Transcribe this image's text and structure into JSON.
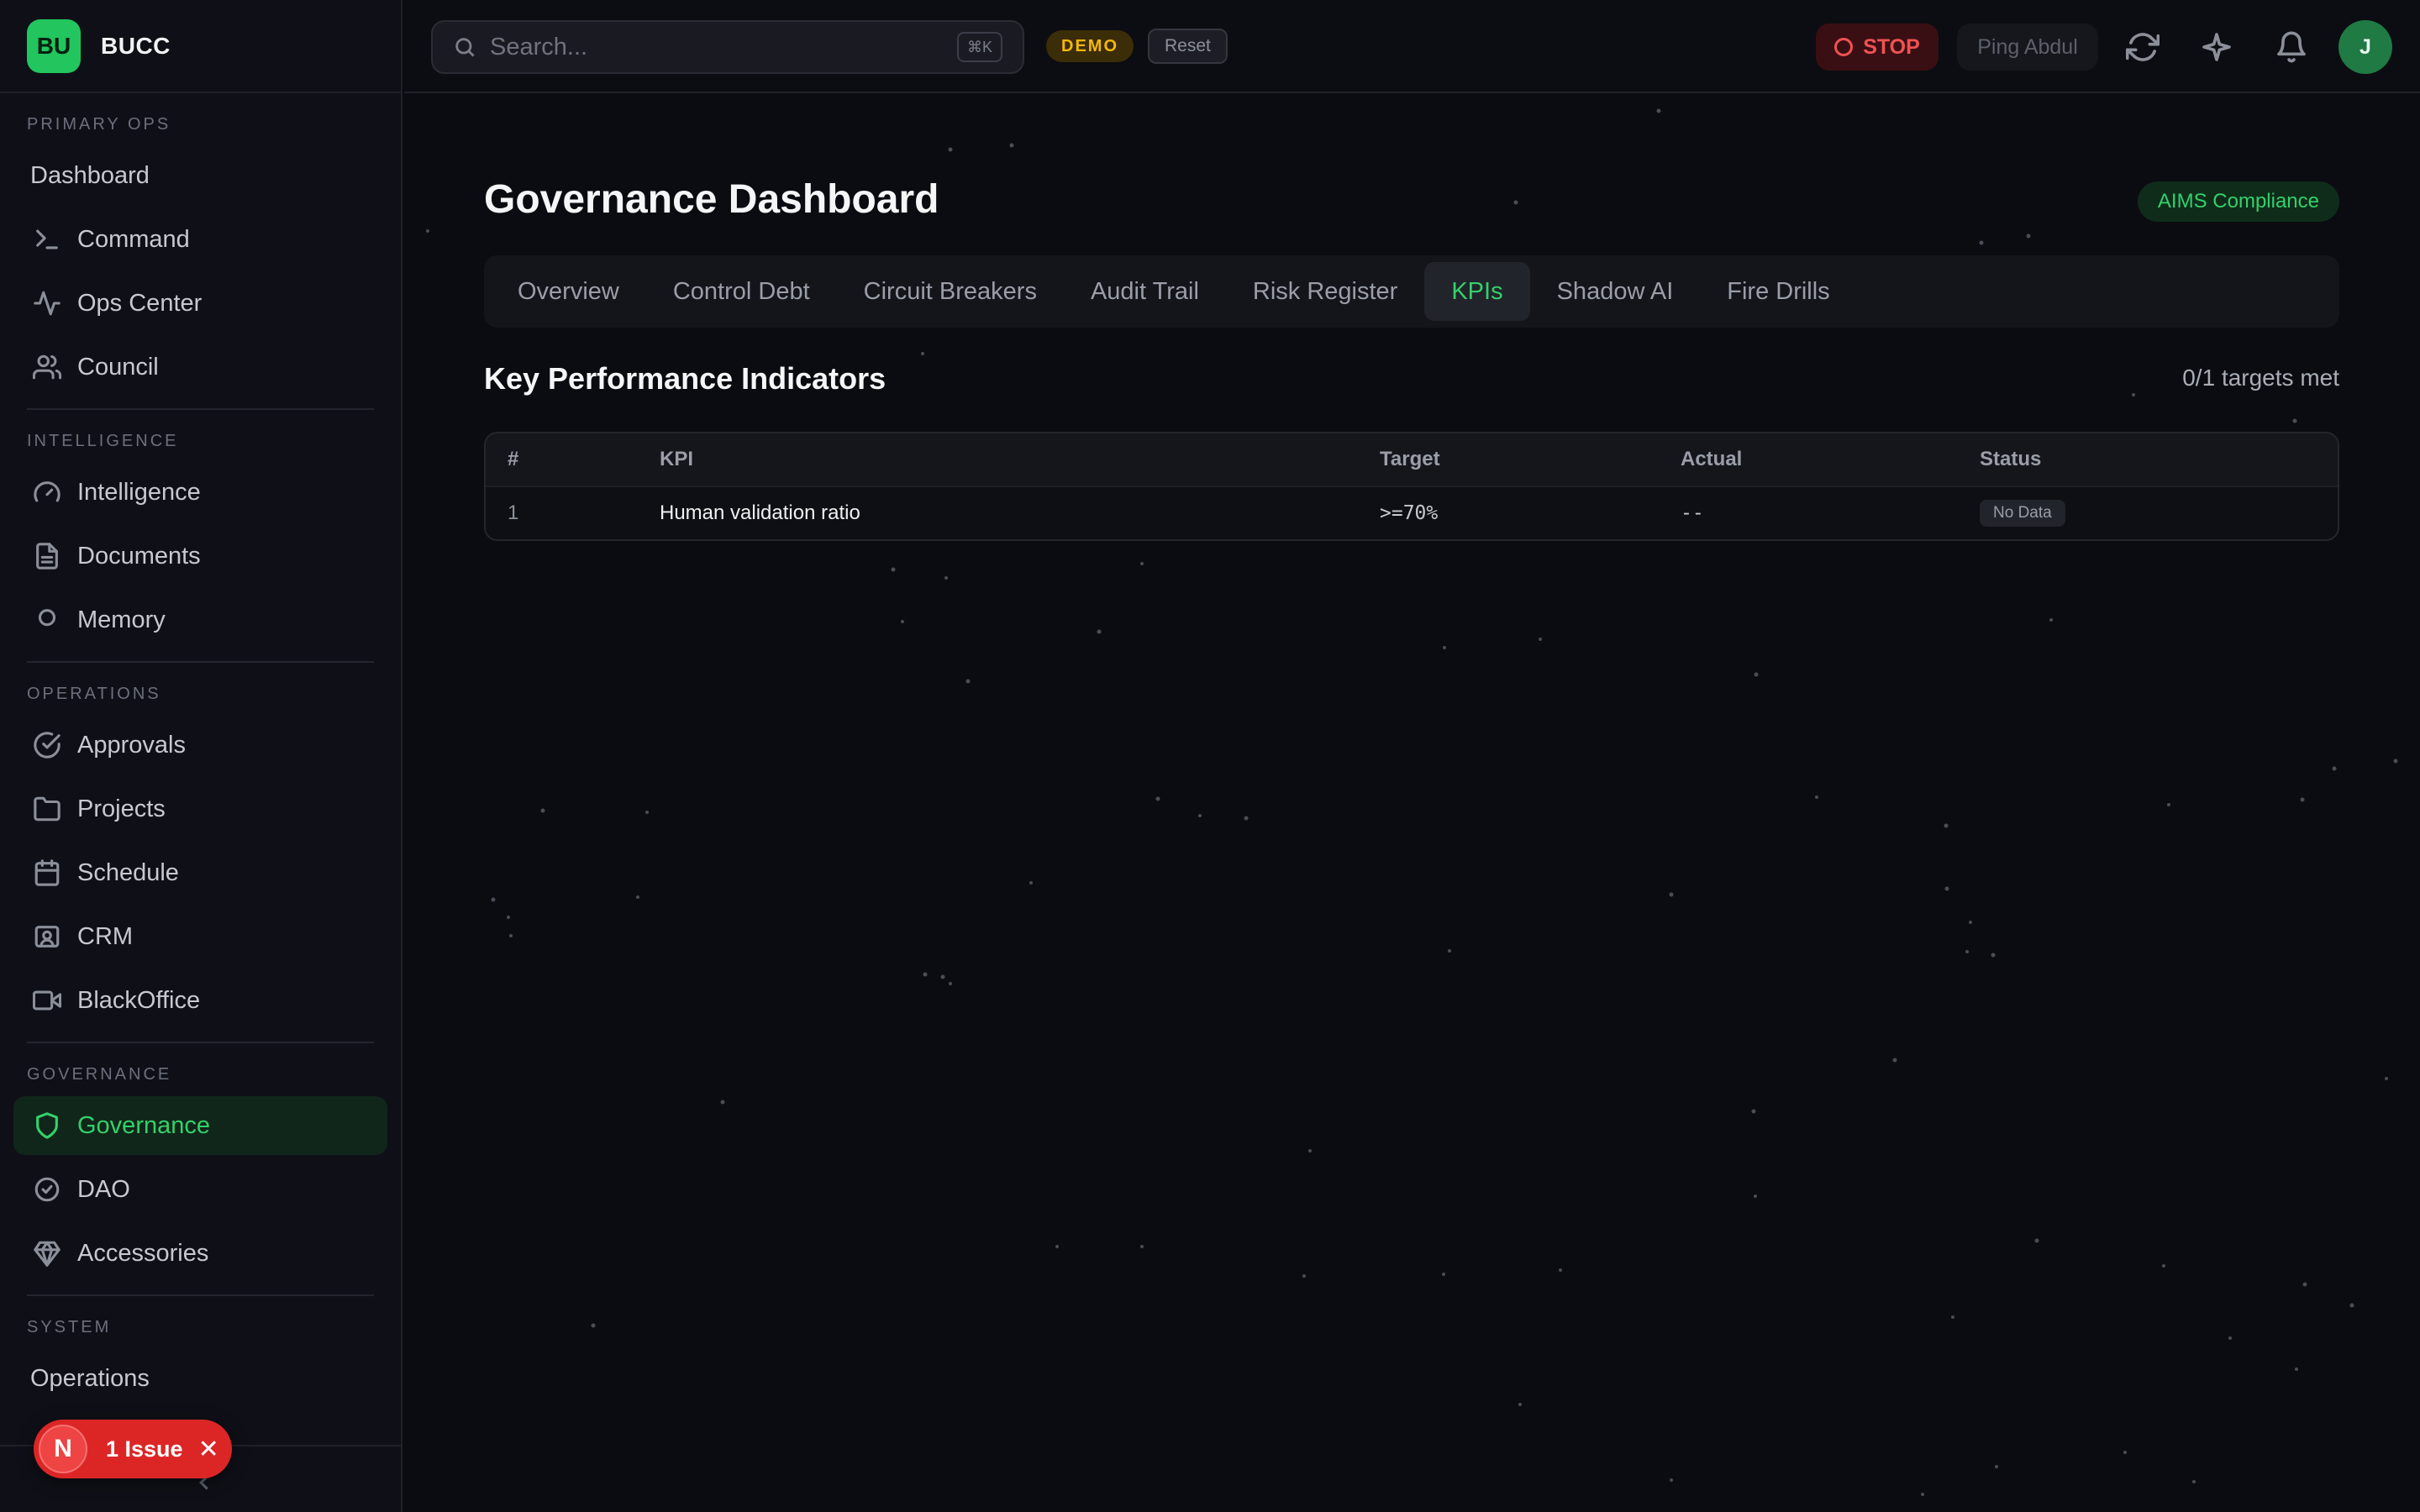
{
  "brand": {
    "logo_text": "BU",
    "name": "BUCC",
    "accent": "#22c55e"
  },
  "sidebar": {
    "sections": [
      {
        "title": "PRIMARY OPS",
        "items": [
          {
            "label": "Dashboard",
            "icon": "none"
          },
          {
            "label": "Command",
            "icon": "terminal-icon"
          },
          {
            "label": "Ops Center",
            "icon": "activity-icon"
          },
          {
            "label": "Council",
            "icon": "users-icon"
          }
        ]
      },
      {
        "title": "INTELLIGENCE",
        "items": [
          {
            "label": "Intelligence",
            "icon": "gauge-icon"
          },
          {
            "label": "Documents",
            "icon": "document-icon"
          },
          {
            "label": "Memory",
            "icon": "circle-icon"
          }
        ]
      },
      {
        "title": "OPERATIONS",
        "items": [
          {
            "label": "Approvals",
            "icon": "check-circle-icon"
          },
          {
            "label": "Projects",
            "icon": "folder-icon"
          },
          {
            "label": "Schedule",
            "icon": "calendar-icon"
          },
          {
            "label": "CRM",
            "icon": "contact-card-icon"
          },
          {
            "label": "BlackOffice",
            "icon": "video-icon"
          }
        ]
      },
      {
        "title": "GOVERNANCE",
        "items": [
          {
            "label": "Governance",
            "icon": "shield-icon",
            "active": true
          },
          {
            "label": "DAO",
            "icon": "badge-check-icon"
          },
          {
            "label": "Accessories",
            "icon": "gem-icon"
          }
        ]
      },
      {
        "title": "SYSTEM",
        "items": [
          {
            "label": "Operations",
            "icon": "none"
          }
        ]
      }
    ]
  },
  "issue_pill": {
    "letter": "N",
    "label": "1 Issue",
    "close": "✕"
  },
  "header": {
    "search_placeholder": "Search...",
    "search_shortcut": "⌘K",
    "demo_badge": "DEMO",
    "reset_label": "Reset",
    "stop_label": "STOP",
    "ping_label": "Ping Abdul",
    "avatar_initial": "J"
  },
  "main": {
    "title": "Governance Dashboard",
    "compliance_badge": "AIMS Compliance",
    "tabs": [
      {
        "label": "Overview"
      },
      {
        "label": "Control Debt"
      },
      {
        "label": "Circuit Breakers"
      },
      {
        "label": "Audit Trail"
      },
      {
        "label": "Risk Register"
      },
      {
        "label": "KPIs",
        "active": true
      },
      {
        "label": "Shadow AI"
      },
      {
        "label": "Fire Drills"
      }
    ],
    "section_title": "Key Performance Indicators",
    "targets_summary": "0/1 targets met",
    "table": {
      "headers": [
        "#",
        "KPI",
        "Target",
        "Actual",
        "Status"
      ],
      "rows": [
        {
          "num": "1",
          "kpi": "Human validation ratio",
          "target": ">=70%",
          "actual": "--",
          "status": "No Data"
        }
      ]
    }
  },
  "colors": {
    "accent_green": "#34d06a",
    "stop_red": "#f05252",
    "demo_amber": "#f5b70b",
    "background": "#0b0c11"
  }
}
